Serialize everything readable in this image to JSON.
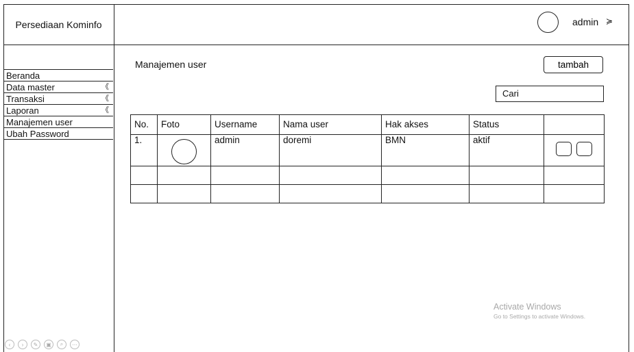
{
  "brand": {
    "title": "Persediaan Kominfo"
  },
  "header": {
    "user_label": "admin",
    "user_chevron": "≽",
    "avatar_icon": "avatar-circle"
  },
  "sidebar": {
    "items": [
      {
        "label": "Beranda",
        "chevron": ""
      },
      {
        "label": "Data master",
        "chevron": "《"
      },
      {
        "label": "Transaksi",
        "chevron": "《"
      },
      {
        "label": "Laporan",
        "chevron": "《"
      },
      {
        "label": "Manajemen user",
        "chevron": ""
      },
      {
        "label": "Ubah Password",
        "chevron": ""
      }
    ]
  },
  "main": {
    "title": "Manajemen user",
    "add_button": "tambah",
    "search_placeholder": "Cari",
    "table": {
      "columns": [
        "No.",
        "Foto",
        "Username",
        "Nama user",
        "Hak akses",
        "Status",
        ""
      ],
      "rows": [
        {
          "no": "1.",
          "username": "admin",
          "nama_user": "doremi",
          "hak_akses": "BMN",
          "status": "aktif"
        }
      ]
    }
  },
  "watermark": {
    "line1": "Activate Windows",
    "line2": "Go to Settings to activate Windows."
  }
}
